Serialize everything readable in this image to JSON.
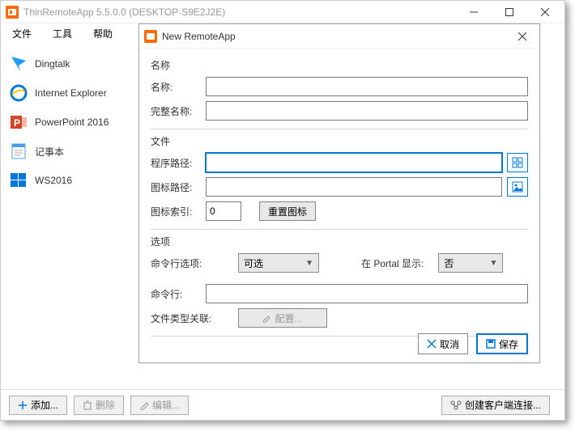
{
  "window": {
    "title": "ThinRemoteApp 5.5.0.0 (DESKTOP-S9E2J2E)"
  },
  "menubar": {
    "file": "文件",
    "tools": "工具",
    "help": "帮助"
  },
  "apps": [
    {
      "name": "Dingtalk",
      "iconColor": "#1e9bff"
    },
    {
      "name": "Internet Explorer",
      "iconColor": "#0078d7"
    },
    {
      "name": "PowerPoint 2016",
      "iconColor": "#d24726"
    },
    {
      "name": "记事本",
      "iconColor": "#4aa0e6"
    },
    {
      "name": "WS2016",
      "iconColor": "#0078d7"
    }
  ],
  "bottombar": {
    "add": "添加...",
    "delete": "删除",
    "edit": "编辑...",
    "createClient": "创建客户端连接..."
  },
  "dialog": {
    "title": "New RemoteApp",
    "group_name": "名称",
    "label_name": "名称:",
    "label_fullname": "完整名称:",
    "group_file": "文件",
    "label_progpath": "程序路径:",
    "label_iconpath": "图标路径:",
    "label_iconindex": "图标索引:",
    "iconindex_value": "0",
    "reset_icon": "重置图标",
    "group_options": "选项",
    "label_cmdopt": "命令行选项:",
    "cmdopt_value": "可选",
    "label_portal": "在 Portal 显示:",
    "portal_value": "否",
    "label_cmdline": "命令行:",
    "label_fileassoc": "文件类型关联:",
    "config": "配置...",
    "cancel": "取消",
    "save": "保存"
  }
}
